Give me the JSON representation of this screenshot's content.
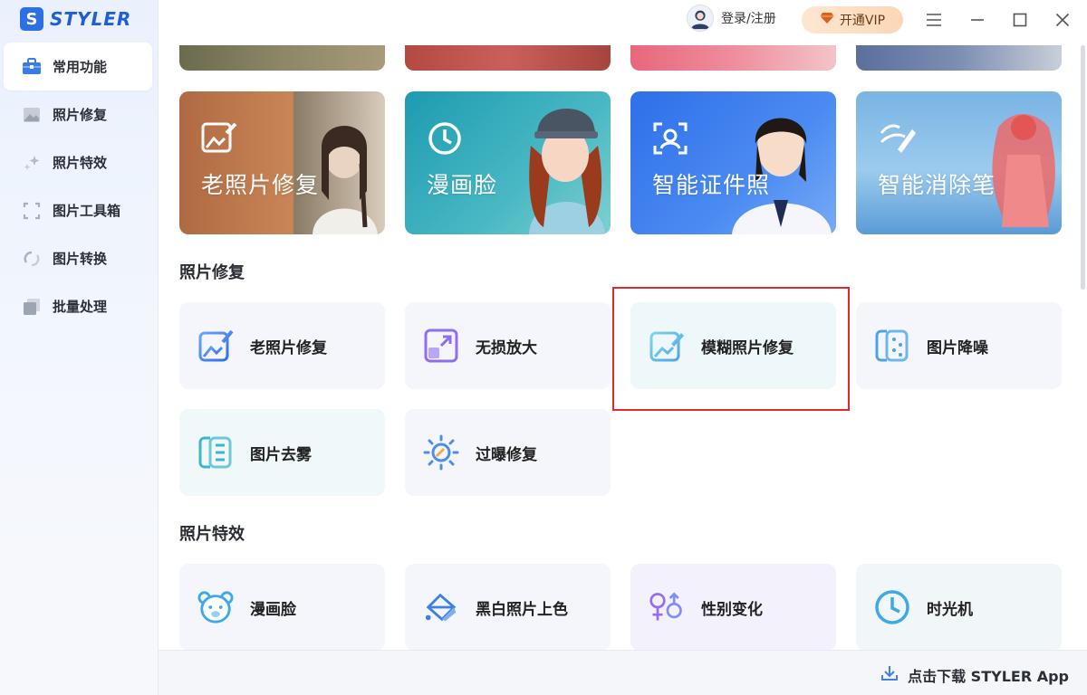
{
  "app": {
    "logo_letter": "S",
    "name": "STYLER"
  },
  "sidebar": {
    "items": [
      {
        "label": "常用功能",
        "icon": "toolbox-icon",
        "active": true
      },
      {
        "label": "照片修复",
        "icon": "photo-icon",
        "active": false
      },
      {
        "label": "照片特效",
        "icon": "sparkle-icon",
        "active": false
      },
      {
        "label": "图片工具箱",
        "icon": "crop-frame-icon",
        "active": false
      },
      {
        "label": "图片转换",
        "icon": "convert-icon",
        "active": false
      },
      {
        "label": "批量处理",
        "icon": "batch-icon",
        "active": false
      }
    ]
  },
  "topbar": {
    "login_label": "登录/注册",
    "vip_label": "开通VIP"
  },
  "banners": [
    {
      "title": "老照片修复",
      "icon": "photo-edit-icon",
      "color_start": "#b06a43",
      "color_end": "#c98556"
    },
    {
      "title": "漫画脸",
      "icon": "clock-icon",
      "color_start": "#2aa6b6",
      "color_end": "#5cc1c8"
    },
    {
      "title": "智能证件照",
      "icon": "id-photo-icon",
      "color_start": "#3d7ef0",
      "color_end": "#6ca0f6"
    },
    {
      "title": "智能消除笔",
      "icon": "eraser-brush-icon",
      "color_start": "#7fb6e4",
      "color_end": "#a9d0ef"
    }
  ],
  "sections": {
    "repair": {
      "title": "照片修复",
      "tools": [
        {
          "label": "老照片修复",
          "icon": "photo-edit-icon"
        },
        {
          "label": "无损放大",
          "icon": "enlarge-icon"
        },
        {
          "label": "模糊照片修复",
          "icon": "blur-repair-icon"
        },
        {
          "label": "图片降噪",
          "icon": "denoise-icon"
        },
        {
          "label": "图片去雾",
          "icon": "dehaze-icon"
        },
        {
          "label": "过曝修复",
          "icon": "sun-icon"
        }
      ]
    },
    "effects": {
      "title": "照片特效",
      "tools": [
        {
          "label": "漫画脸",
          "icon": "bear-face-icon"
        },
        {
          "label": "黑白照片上色",
          "icon": "colorize-icon"
        },
        {
          "label": "性别变化",
          "icon": "gender-icon"
        },
        {
          "label": "时光机",
          "icon": "clock-icon"
        }
      ]
    }
  },
  "footer": {
    "download_label": "点击下载 STYLER App"
  },
  "colors": {
    "accent": "#2f6fe4",
    "highlight": "#e02a2a"
  }
}
